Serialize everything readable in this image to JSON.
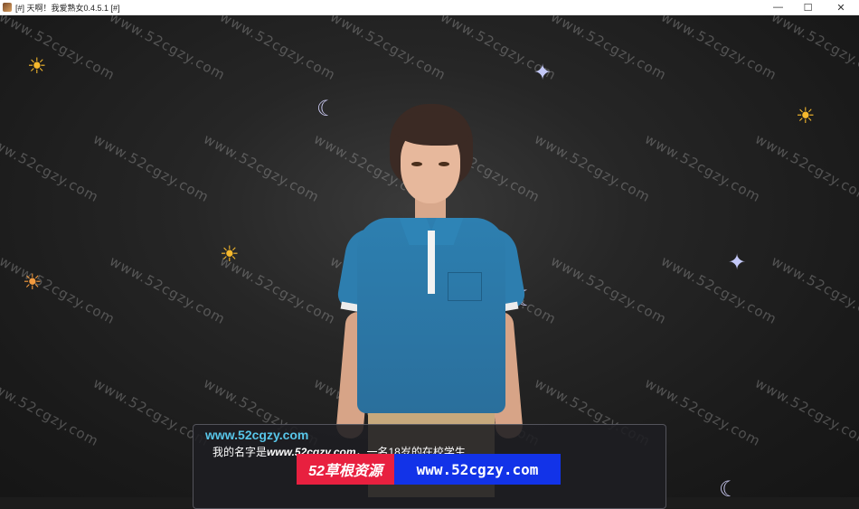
{
  "window": {
    "title": "[#] 天啊！我爱熟女0.4.5.1 [#]",
    "minimize": "—",
    "maximize": "☐",
    "close": "✕"
  },
  "watermark_text": "www.52cgzy.com",
  "dialog": {
    "speaker": "www.52cgzy.com",
    "line_prefix": "我的名字是",
    "line_site": "www.52cgzy.com",
    "line_suffix": "，一名18岁的在校学生."
  },
  "banners": {
    "red": "52草根资源",
    "blue": "www.52cgzy.com"
  },
  "icons": {
    "sun": "☀",
    "moon": "☾",
    "stars": "✦",
    "sunset": "☀"
  },
  "colors": {
    "background": "#1c1c1c",
    "speaker": "#58c6e9",
    "banner_red": "#e8203f",
    "banner_blue": "#1233e8"
  }
}
